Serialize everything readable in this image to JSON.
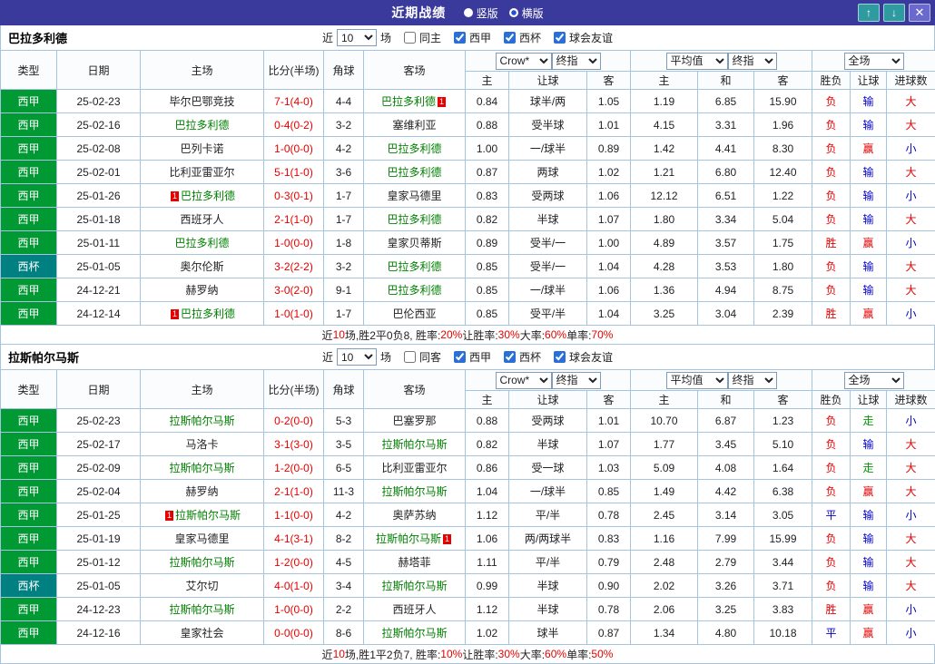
{
  "colors": {
    "red": "#e60000",
    "blue": "#0000cc",
    "green": "#009900",
    "focus_team": "#008000",
    "other_team": "#222222",
    "liga_bg": "#009933",
    "cup_bg": "#008080",
    "titlebar_bg": "#3a3a9c"
  },
  "titlebar": {
    "title": "近期战绩",
    "radios": [
      {
        "label": "竖版",
        "selected": false
      },
      {
        "label": "横版",
        "selected": true
      }
    ],
    "up_icon": "↑",
    "down_icon": "↓",
    "close_icon": "✕"
  },
  "table_header": {
    "cols": [
      "类型",
      "日期",
      "主场",
      "比分(半场)",
      "角球",
      "客场"
    ],
    "odds1_selects": [
      "Crow*",
      "终指"
    ],
    "odds2_selects": [
      "平均值",
      "终指"
    ],
    "scope_select": "全场",
    "sub": [
      "主",
      "让球",
      "客",
      "主",
      "和",
      "客",
      "胜负",
      "让球",
      "进球数"
    ]
  },
  "sections": [
    {
      "team": "巴拉多利德",
      "filter": {
        "near": "近",
        "count": "10",
        "games": "场",
        "checks": [
          {
            "label": "同主",
            "checked": false
          },
          {
            "label": "西甲",
            "checked": true
          },
          {
            "label": "西杯",
            "checked": true
          },
          {
            "label": "球会友谊",
            "checked": true
          }
        ]
      },
      "rows": [
        {
          "lg": "西甲",
          "lgk": "liga",
          "date": "25-02-23",
          "home": {
            "n": "毕尔巴鄂竞技"
          },
          "score": "7-1(4-0)",
          "corner": "4-4",
          "away": {
            "n": "巴拉多利德",
            "f": true,
            "ba": "1"
          },
          "o1": [
            "0.84",
            "球半/两",
            "1.05"
          ],
          "o2": [
            "1.19",
            "6.85",
            "15.90"
          ],
          "res": [
            [
              "负",
              "red"
            ],
            [
              "输",
              "blue"
            ],
            [
              "大",
              "red"
            ]
          ]
        },
        {
          "lg": "西甲",
          "lgk": "liga",
          "date": "25-02-16",
          "home": {
            "n": "巴拉多利德",
            "f": true
          },
          "score": "0-4(0-2)",
          "corner": "3-2",
          "away": {
            "n": "塞维利亚"
          },
          "o1": [
            "0.88",
            "受半球",
            "1.01"
          ],
          "o2": [
            "4.15",
            "3.31",
            "1.96"
          ],
          "res": [
            [
              "负",
              "red"
            ],
            [
              "输",
              "blue"
            ],
            [
              "大",
              "red"
            ]
          ]
        },
        {
          "lg": "西甲",
          "lgk": "liga",
          "date": "25-02-08",
          "home": {
            "n": "巴列卡诺"
          },
          "score": "1-0(0-0)",
          "corner": "4-2",
          "away": {
            "n": "巴拉多利德",
            "f": true
          },
          "o1": [
            "1.00",
            "一/球半",
            "0.89"
          ],
          "o2": [
            "1.42",
            "4.41",
            "8.30"
          ],
          "res": [
            [
              "负",
              "red"
            ],
            [
              "赢",
              "red"
            ],
            [
              "小",
              "blue"
            ]
          ]
        },
        {
          "lg": "西甲",
          "lgk": "liga",
          "date": "25-02-01",
          "home": {
            "n": "比利亚雷亚尔"
          },
          "score": "5-1(1-0)",
          "corner": "3-6",
          "away": {
            "n": "巴拉多利德",
            "f": true
          },
          "o1": [
            "0.87",
            "两球",
            "1.02"
          ],
          "o2": [
            "1.21",
            "6.80",
            "12.40"
          ],
          "res": [
            [
              "负",
              "red"
            ],
            [
              "输",
              "blue"
            ],
            [
              "大",
              "red"
            ]
          ]
        },
        {
          "lg": "西甲",
          "lgk": "liga",
          "date": "25-01-26",
          "home": {
            "n": "巴拉多利德",
            "f": true,
            "bb": "1"
          },
          "score": "0-3(0-1)",
          "corner": "1-7",
          "away": {
            "n": "皇家马德里"
          },
          "o1": [
            "0.83",
            "受两球",
            "1.06"
          ],
          "o2": [
            "12.12",
            "6.51",
            "1.22"
          ],
          "res": [
            [
              "负",
              "red"
            ],
            [
              "输",
              "blue"
            ],
            [
              "小",
              "blue"
            ]
          ]
        },
        {
          "lg": "西甲",
          "lgk": "liga",
          "date": "25-01-18",
          "home": {
            "n": "西班牙人"
          },
          "score": "2-1(1-0)",
          "corner": "1-7",
          "away": {
            "n": "巴拉多利德",
            "f": true
          },
          "o1": [
            "0.82",
            "半球",
            "1.07"
          ],
          "o2": [
            "1.80",
            "3.34",
            "5.04"
          ],
          "res": [
            [
              "负",
              "red"
            ],
            [
              "输",
              "blue"
            ],
            [
              "大",
              "red"
            ]
          ]
        },
        {
          "lg": "西甲",
          "lgk": "liga",
          "date": "25-01-11",
          "home": {
            "n": "巴拉多利德",
            "f": true
          },
          "score": "1-0(0-0)",
          "corner": "1-8",
          "away": {
            "n": "皇家贝蒂斯"
          },
          "o1": [
            "0.89",
            "受半/一",
            "1.00"
          ],
          "o2": [
            "4.89",
            "3.57",
            "1.75"
          ],
          "res": [
            [
              "胜",
              "red"
            ],
            [
              "赢",
              "red"
            ],
            [
              "小",
              "blue"
            ]
          ]
        },
        {
          "lg": "西杯",
          "lgk": "cup",
          "date": "25-01-05",
          "home": {
            "n": "奥尔伦斯"
          },
          "score": "3-2(2-2)",
          "corner": "3-2",
          "away": {
            "n": "巴拉多利德",
            "f": true
          },
          "o1": [
            "0.85",
            "受半/一",
            "1.04"
          ],
          "o2": [
            "4.28",
            "3.53",
            "1.80"
          ],
          "res": [
            [
              "负",
              "red"
            ],
            [
              "输",
              "blue"
            ],
            [
              "大",
              "red"
            ]
          ]
        },
        {
          "lg": "西甲",
          "lgk": "liga",
          "date": "24-12-21",
          "home": {
            "n": "赫罗纳"
          },
          "score": "3-0(2-0)",
          "corner": "9-1",
          "away": {
            "n": "巴拉多利德",
            "f": true
          },
          "o1": [
            "0.85",
            "一/球半",
            "1.06"
          ],
          "o2": [
            "1.36",
            "4.94",
            "8.75"
          ],
          "res": [
            [
              "负",
              "red"
            ],
            [
              "输",
              "blue"
            ],
            [
              "大",
              "red"
            ]
          ]
        },
        {
          "lg": "西甲",
          "lgk": "liga",
          "date": "24-12-14",
          "home": {
            "n": "巴拉多利德",
            "f": true,
            "bb": "1"
          },
          "score": "1-0(1-0)",
          "corner": "1-7",
          "away": {
            "n": "巴伦西亚"
          },
          "o1": [
            "0.85",
            "受平/半",
            "1.04"
          ],
          "o2": [
            "3.25",
            "3.04",
            "2.39"
          ],
          "res": [
            [
              "胜",
              "red"
            ],
            [
              "赢",
              "red"
            ],
            [
              "小",
              "blue"
            ]
          ]
        }
      ],
      "footer": [
        [
          "近",
          "k"
        ],
        [
          "10",
          "r"
        ],
        [
          "场,胜2平0负8, 胜率:",
          "k"
        ],
        [
          "20%",
          "r"
        ],
        [
          " 让胜率:",
          "k"
        ],
        [
          "30%",
          "r"
        ],
        [
          " 大率:",
          "k"
        ],
        [
          "60%",
          "r"
        ],
        [
          " 单率:",
          "k"
        ],
        [
          "70%",
          "r"
        ]
      ]
    },
    {
      "team": "拉斯帕尔马斯",
      "filter": {
        "near": "近",
        "count": "10",
        "games": "场",
        "checks": [
          {
            "label": "同客",
            "checked": false
          },
          {
            "label": "西甲",
            "checked": true
          },
          {
            "label": "西杯",
            "checked": true
          },
          {
            "label": "球会友谊",
            "checked": true
          }
        ]
      },
      "rows": [
        {
          "lg": "西甲",
          "lgk": "liga",
          "date": "25-02-23",
          "home": {
            "n": "拉斯帕尔马斯",
            "f": true
          },
          "score": "0-2(0-0)",
          "corner": "5-3",
          "away": {
            "n": "巴塞罗那"
          },
          "o1": [
            "0.88",
            "受两球",
            "1.01"
          ],
          "o2": [
            "10.70",
            "6.87",
            "1.23"
          ],
          "res": [
            [
              "负",
              "red"
            ],
            [
              "走",
              "green"
            ],
            [
              "小",
              "blue"
            ]
          ]
        },
        {
          "lg": "西甲",
          "lgk": "liga",
          "date": "25-02-17",
          "home": {
            "n": "马洛卡"
          },
          "score": "3-1(3-0)",
          "corner": "3-5",
          "away": {
            "n": "拉斯帕尔马斯",
            "f": true
          },
          "o1": [
            "0.82",
            "半球",
            "1.07"
          ],
          "o2": [
            "1.77",
            "3.45",
            "5.10"
          ],
          "res": [
            [
              "负",
              "red"
            ],
            [
              "输",
              "blue"
            ],
            [
              "大",
              "red"
            ]
          ]
        },
        {
          "lg": "西甲",
          "lgk": "liga",
          "date": "25-02-09",
          "home": {
            "n": "拉斯帕尔马斯",
            "f": true
          },
          "score": "1-2(0-0)",
          "corner": "6-5",
          "away": {
            "n": "比利亚雷亚尔"
          },
          "o1": [
            "0.86",
            "受一球",
            "1.03"
          ],
          "o2": [
            "5.09",
            "4.08",
            "1.64"
          ],
          "res": [
            [
              "负",
              "red"
            ],
            [
              "走",
              "green"
            ],
            [
              "大",
              "red"
            ]
          ]
        },
        {
          "lg": "西甲",
          "lgk": "liga",
          "date": "25-02-04",
          "home": {
            "n": "赫罗纳"
          },
          "score": "2-1(1-0)",
          "corner": "11-3",
          "away": {
            "n": "拉斯帕尔马斯",
            "f": true
          },
          "o1": [
            "1.04",
            "一/球半",
            "0.85"
          ],
          "o2": [
            "1.49",
            "4.42",
            "6.38"
          ],
          "res": [
            [
              "负",
              "red"
            ],
            [
              "赢",
              "red"
            ],
            [
              "大",
              "red"
            ]
          ]
        },
        {
          "lg": "西甲",
          "lgk": "liga",
          "date": "25-01-25",
          "home": {
            "n": "拉斯帕尔马斯",
            "f": true,
            "bb": "1"
          },
          "score": "1-1(0-0)",
          "corner": "4-2",
          "away": {
            "n": "奥萨苏纳"
          },
          "o1": [
            "1.12",
            "平/半",
            "0.78"
          ],
          "o2": [
            "2.45",
            "3.14",
            "3.05"
          ],
          "res": [
            [
              "平",
              "blue"
            ],
            [
              "输",
              "blue"
            ],
            [
              "小",
              "blue"
            ]
          ]
        },
        {
          "lg": "西甲",
          "lgk": "liga",
          "date": "25-01-19",
          "home": {
            "n": "皇家马德里"
          },
          "score": "4-1(3-1)",
          "corner": "8-2",
          "away": {
            "n": "拉斯帕尔马斯",
            "f": true,
            "ba": "1"
          },
          "o1": [
            "1.06",
            "两/两球半",
            "0.83"
          ],
          "o2": [
            "1.16",
            "7.99",
            "15.99"
          ],
          "res": [
            [
              "负",
              "red"
            ],
            [
              "输",
              "blue"
            ],
            [
              "大",
              "red"
            ]
          ]
        },
        {
          "lg": "西甲",
          "lgk": "liga",
          "date": "25-01-12",
          "home": {
            "n": "拉斯帕尔马斯",
            "f": true
          },
          "score": "1-2(0-0)",
          "corner": "4-5",
          "away": {
            "n": "赫塔菲"
          },
          "o1": [
            "1.11",
            "平/半",
            "0.79"
          ],
          "o2": [
            "2.48",
            "2.79",
            "3.44"
          ],
          "res": [
            [
              "负",
              "red"
            ],
            [
              "输",
              "blue"
            ],
            [
              "大",
              "red"
            ]
          ]
        },
        {
          "lg": "西杯",
          "lgk": "cup",
          "date": "25-01-05",
          "home": {
            "n": "艾尔切"
          },
          "score": "4-0(1-0)",
          "corner": "3-4",
          "away": {
            "n": "拉斯帕尔马斯",
            "f": true
          },
          "o1": [
            "0.99",
            "半球",
            "0.90"
          ],
          "o2": [
            "2.02",
            "3.26",
            "3.71"
          ],
          "res": [
            [
              "负",
              "red"
            ],
            [
              "输",
              "blue"
            ],
            [
              "大",
              "red"
            ]
          ]
        },
        {
          "lg": "西甲",
          "lgk": "liga",
          "date": "24-12-23",
          "home": {
            "n": "拉斯帕尔马斯",
            "f": true
          },
          "score": "1-0(0-0)",
          "corner": "2-2",
          "away": {
            "n": "西班牙人"
          },
          "o1": [
            "1.12",
            "半球",
            "0.78"
          ],
          "o2": [
            "2.06",
            "3.25",
            "3.83"
          ],
          "res": [
            [
              "胜",
              "red"
            ],
            [
              "赢",
              "red"
            ],
            [
              "小",
              "blue"
            ]
          ]
        },
        {
          "lg": "西甲",
          "lgk": "liga",
          "date": "24-12-16",
          "home": {
            "n": "皇家社会"
          },
          "score": "0-0(0-0)",
          "corner": "8-6",
          "away": {
            "n": "拉斯帕尔马斯",
            "f": true
          },
          "o1": [
            "1.02",
            "球半",
            "0.87"
          ],
          "o2": [
            "1.34",
            "4.80",
            "10.18"
          ],
          "res": [
            [
              "平",
              "blue"
            ],
            [
              "赢",
              "red"
            ],
            [
              "小",
              "blue"
            ]
          ]
        }
      ],
      "footer": [
        [
          "近",
          "k"
        ],
        [
          "10",
          "r"
        ],
        [
          "场,胜1平2负7, 胜率:",
          "k"
        ],
        [
          "10%",
          "r"
        ],
        [
          " 让胜率:",
          "k"
        ],
        [
          "30%",
          "r"
        ],
        [
          " 大率:",
          "k"
        ],
        [
          "60%",
          "r"
        ],
        [
          " 单率:",
          "k"
        ],
        [
          "50%",
          "r"
        ]
      ]
    }
  ]
}
